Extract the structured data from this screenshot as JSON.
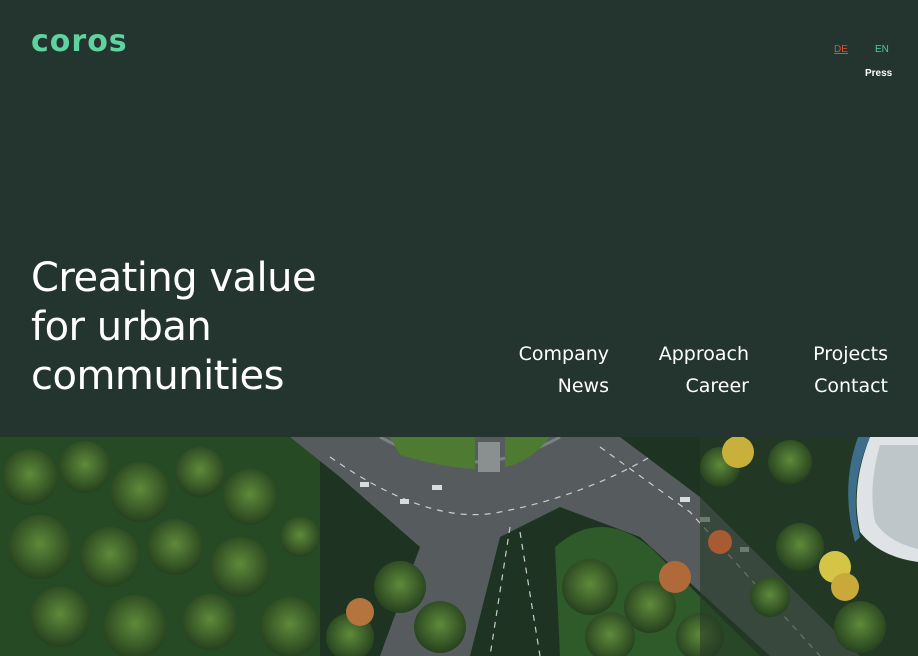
{
  "brand": {
    "logo_text": "coros"
  },
  "topbar": {
    "languages": [
      {
        "code": "DE",
        "active": true,
        "color": "#e0502a"
      },
      {
        "code": "EN",
        "active": false,
        "color": "#4ecb93"
      }
    ],
    "press_label": "Press"
  },
  "hero": {
    "title_lines": [
      "Creating value",
      "for urban",
      "communities"
    ]
  },
  "nav": {
    "columns": [
      [
        "Company",
        "News"
      ],
      [
        "Approach",
        "Career"
      ],
      [
        "Projects",
        "Contact"
      ]
    ]
  },
  "colors": {
    "background": "#243530",
    "accent": "#5fd39f",
    "text": "#ffffff"
  },
  "image": {
    "subject": "aerial-roundabout-with-trees"
  }
}
